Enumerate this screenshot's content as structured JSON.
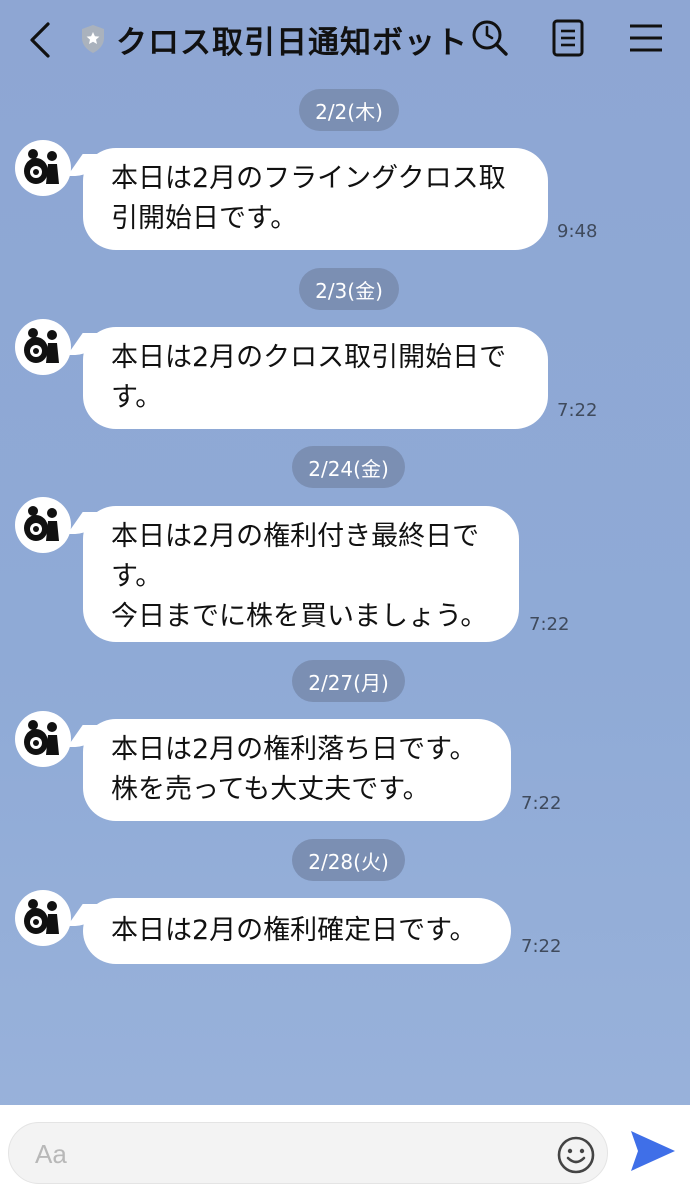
{
  "header": {
    "title": "クロス取引日通知ボット",
    "back_icon": "chevron-left-icon",
    "badge_icon": "shield-star-icon",
    "search_icon": "clock-search-icon",
    "notes_icon": "note-icon",
    "menu_icon": "hamburger-menu-icon"
  },
  "messages": [
    {
      "date": "2/2(木)",
      "lines": [
        "本日は2月のフライングクロス取",
        "引開始日です。"
      ],
      "time": "9:48"
    },
    {
      "date": "2/3(金)",
      "lines": [
        "本日は2月のクロス取引開始日で",
        "す。"
      ],
      "time": "7:22"
    },
    {
      "date": "2/24(金)",
      "lines": [
        "本日は2月の権利付き最終日で",
        "す。",
        "今日までに株を買いましょう。"
      ],
      "time": "7:22"
    },
    {
      "date": "2/27(月)",
      "lines": [
        "本日は2月の権利落ち日です。",
        "株を売っても大丈夫です。"
      ],
      "time": "7:22"
    },
    {
      "date": "2/28(火)",
      "lines": [
        "本日は2月の権利確定日です。"
      ],
      "time": "7:22"
    }
  ],
  "composer": {
    "placeholder": "Aa",
    "emoji_icon": "smiley-icon",
    "send_icon": "send-arrow-icon"
  },
  "colors": {
    "background": "#8fa8d5",
    "date_pill": "#7b8fb3",
    "bubble": "#ffffff",
    "send": "#3f6fe8"
  }
}
